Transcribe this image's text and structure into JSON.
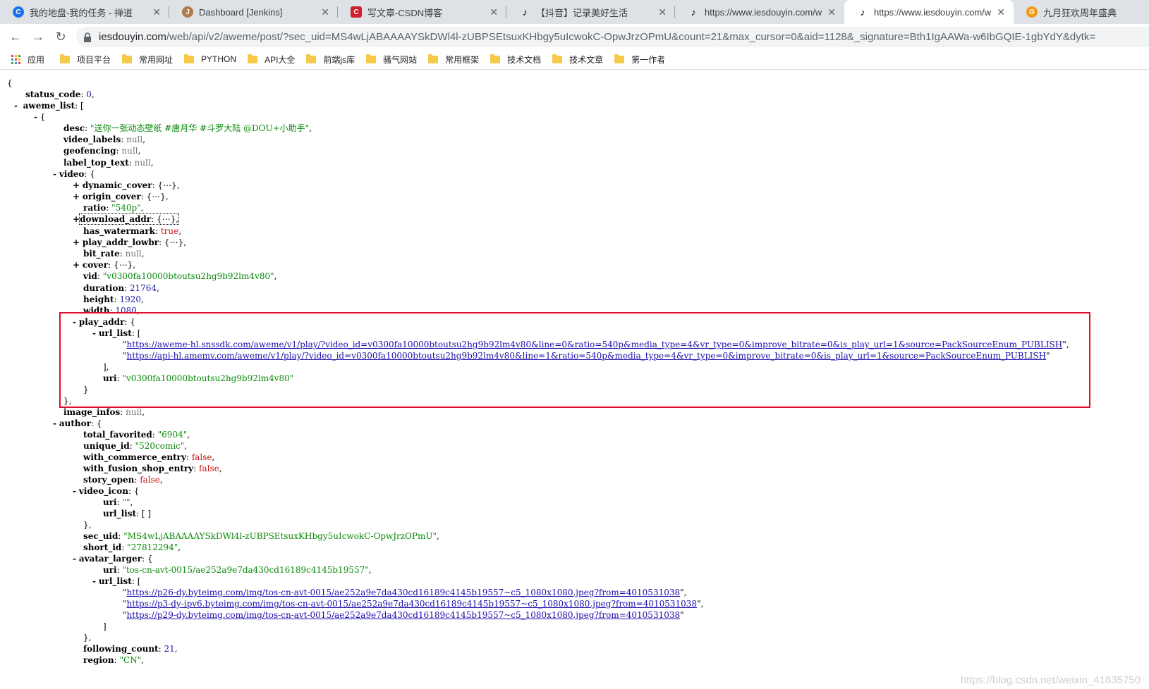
{
  "tabs": [
    {
      "label": "我的地盘-我的任务 - 禅道",
      "icon": "zentao-icon",
      "color": "#1a73e8"
    },
    {
      "label": "Dashboard [Jenkins]",
      "icon": "jenkins-icon",
      "color": "#b07a4a"
    },
    {
      "label": "写文章-CSDN博客",
      "icon": "csdn-icon",
      "color": "#d0202a"
    },
    {
      "label": "【抖音】记录美好生活",
      "icon": "douyin-icon",
      "color": "#111111"
    },
    {
      "label": "https://www.iesdouyin.com/w",
      "icon": "douyin-icon",
      "color": "#111111"
    },
    {
      "label": "https://www.iesdouyin.com/w",
      "icon": "douyin-icon",
      "color": "#111111"
    },
    {
      "label": "九月狂欢周年盛典",
      "icon": "promo-icon",
      "color": "#f29a12"
    }
  ],
  "address": {
    "host": "iesdouyin.com",
    "path": "/web/api/v2/aweme/post/?sec_uid=MS4wLjABAAAAYSkDWl4l-zUBPSEtsuxKHbgy5uIcwokC-OpwJrzOPmU&count=21&max_cursor=0&aid=1128&_signature=Bth1IgAAWa-w6IbGQIE-1gbYdY&dytk="
  },
  "bookmarks": [
    "应用",
    "项目平台",
    "常用网址",
    "PYTHON",
    "API大全",
    "前端js库",
    "骚气网站",
    "常用框架",
    "技术文档",
    "技术文章",
    "第一作者"
  ],
  "json": {
    "status_code": "0",
    "desc": "\"送你一张动态壁纸 #唐月华 #斗罗大陆 @DOU+小助手\"",
    "ratio": "\"540p\"",
    "vid": "\"v0300fa10000btoutsu2hg9b92lm4v80\"",
    "duration": "21764",
    "height": "1920",
    "width": "1080",
    "play_url_1": "https://aweme-hl.snssdk.com/aweme/v1/play/?video_id=v0300fa10000btoutsu2hg9b92lm4v80&line=0&ratio=540p&media_type=4&vr_type=0&improve_bitrate=0&is_play_url=1&source=PackSourceEnum_PUBLISH",
    "play_url_2": "https://api-hl.amemv.com/aweme/v1/play/?video_id=v0300fa10000btoutsu2hg9b92lm4v80&line=1&ratio=540p&media_type=4&vr_type=0&improve_bitrate=0&is_play_url=1&source=PackSourceEnum_PUBLISH",
    "play_uri": "\"v0300fa10000btoutsu2hg9b92lm4v80\"",
    "total_favorited": "\"6904\"",
    "unique_id": "\"520comic\"",
    "video_icon_uri": "\"\"",
    "sec_uid": "\"MS4wLjABAAAAYSkDWl4l-zUBPSEtsuxKHbgy5uIcwokC-OpwJrzOPmU\"",
    "short_id": "\"27812294\"",
    "avatar_uri": "\"tos-cn-avt-0015/ae252a9e7da430cd16189c4145b19557\"",
    "avatar_url_1": "https://p26-dy.byteimg.com/img/tos-cn-avt-0015/ae252a9e7da430cd16189c4145b19557~c5_1080x1080.jpeg?from=4010531038",
    "avatar_url_2": "https://p3-dy-ipv6.byteimg.com/img/tos-cn-avt-0015/ae252a9e7da430cd16189c4145b19557~c5_1080x1080.jpeg?from=4010531038",
    "avatar_url_3": "https://p29-dy.byteimg.com/img/tos-cn-avt-0015/ae252a9e7da430cd16189c4145b19557~c5_1080x1080.jpeg?from=4010531038",
    "following_count": "21",
    "region": "\"CN\""
  },
  "watermark": "https://blog.csdn.net/weixin_41635750"
}
